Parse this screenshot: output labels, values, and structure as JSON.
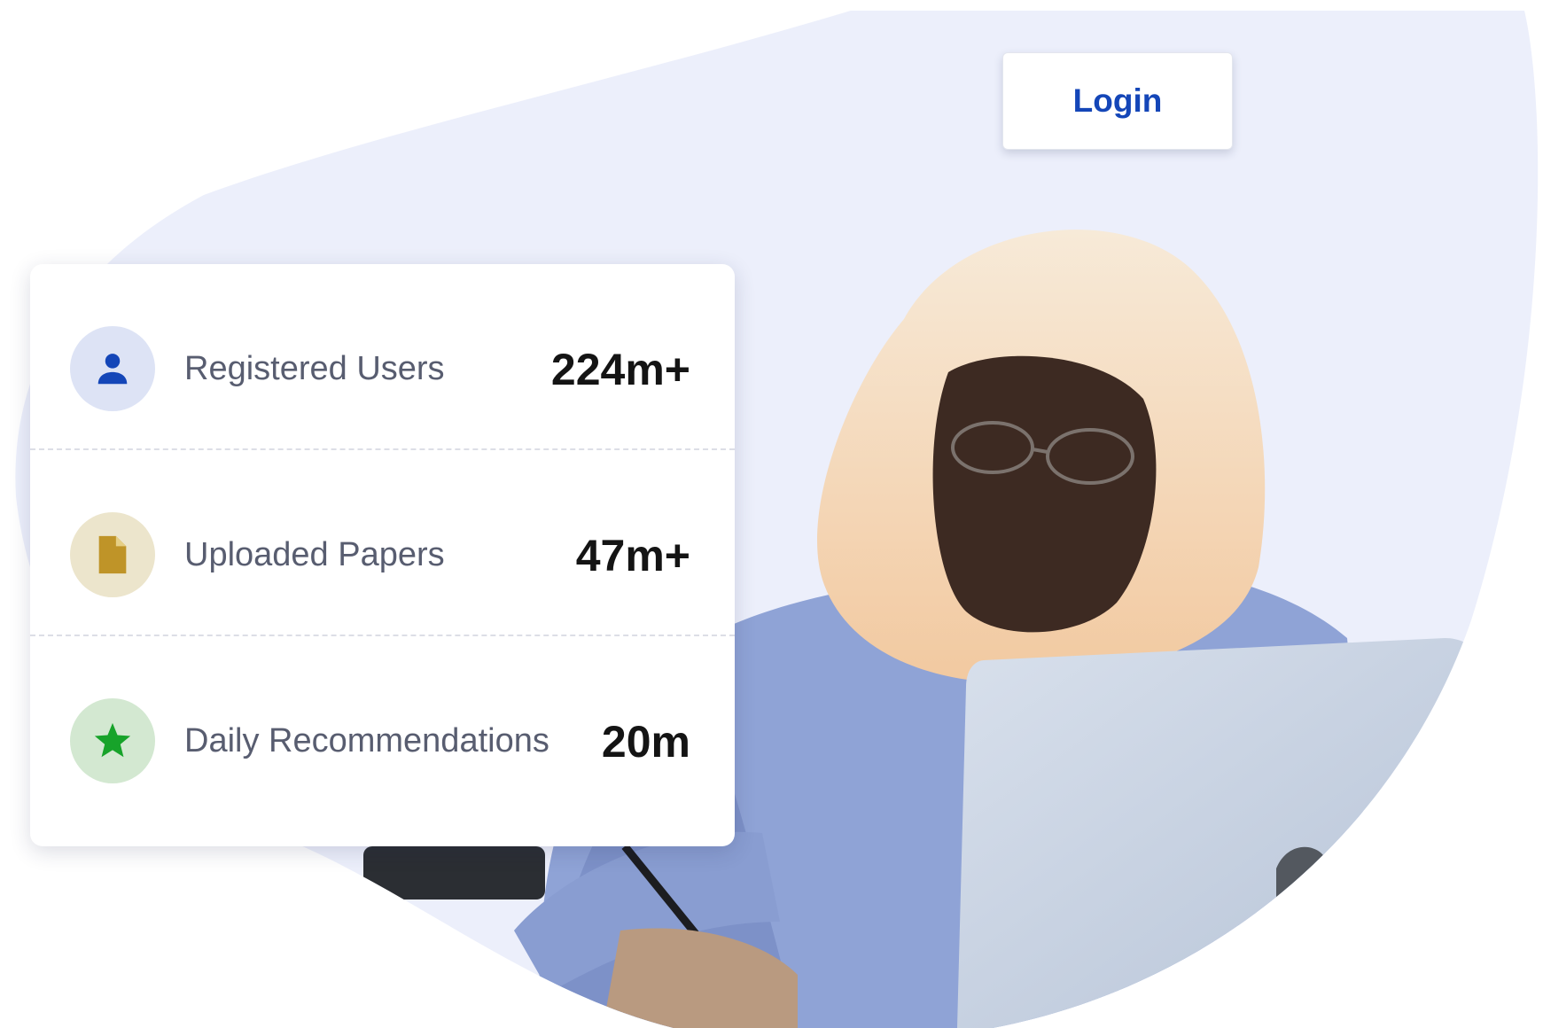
{
  "header": {
    "login_label": "Login"
  },
  "stats": [
    {
      "label": "Registered Users",
      "value": "224m+",
      "icon": "user-icon",
      "icon_bg": "#dde3f5",
      "icon_color": "#1446b8"
    },
    {
      "label": "Uploaded Papers",
      "value": "47m+",
      "icon": "document-icon",
      "icon_bg": "#ece5cc",
      "icon_color": "#bf9428"
    },
    {
      "label": "Daily Recommendations",
      "value": "20m",
      "icon": "star-icon",
      "icon_bg": "#d3e8d1",
      "icon_color": "#17a32a"
    }
  ],
  "colors": {
    "accent": "#1446b8",
    "hero_background": "#eceffb",
    "stat_value": "#141414",
    "stat_label": "#585d70"
  }
}
